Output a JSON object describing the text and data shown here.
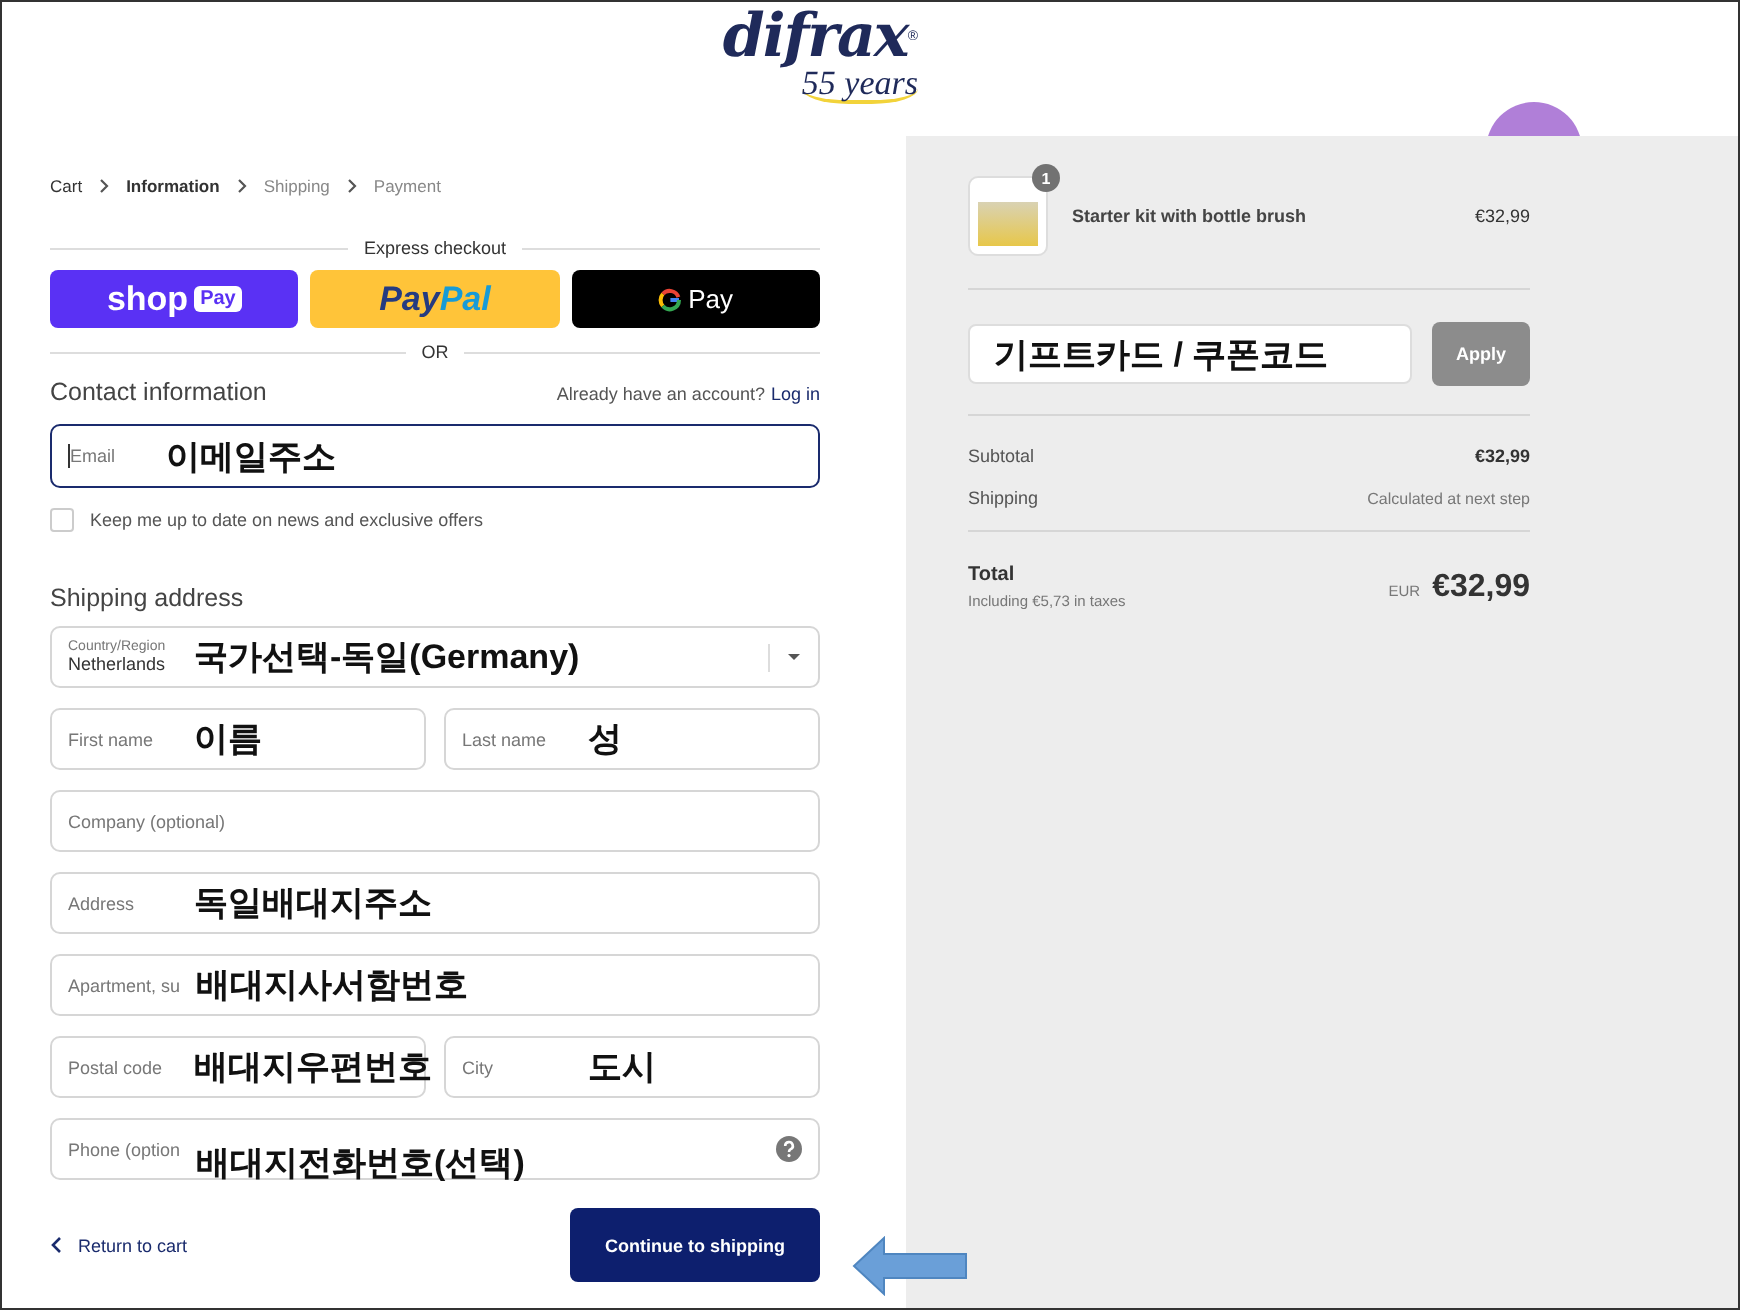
{
  "logo": {
    "wordmark": "difrax",
    "registered": "®",
    "tagline": "55 years"
  },
  "breadcrumbs": [
    {
      "label": "Cart",
      "selected": false,
      "disabled": false
    },
    {
      "label": "Information",
      "selected": true,
      "disabled": false
    },
    {
      "label": "Shipping",
      "selected": false,
      "disabled": true
    },
    {
      "label": "Payment",
      "selected": false,
      "disabled": true
    }
  ],
  "express_checkout": {
    "title": "Express checkout",
    "buttons": [
      {
        "kind": "shop",
        "label": "shop",
        "badge": "Pay"
      },
      {
        "kind": "paypal",
        "label": "Pay",
        "label_2": "Pal"
      },
      {
        "kind": "gpay",
        "label": "Pay"
      }
    ],
    "divider": "OR"
  },
  "contact": {
    "title": "Contact information",
    "account_prompt": "Already have an account?",
    "login_link": "Log in",
    "email": {
      "placeholder": "Email",
      "focused": true,
      "note": "이메일주소"
    },
    "newsletter": {
      "label": "Keep me up to date on news and exclusive offers",
      "checked": false
    }
  },
  "shipping": {
    "title": "Shipping address",
    "rows": [
      [
        {
          "kind": "select",
          "label": "Country/Region",
          "value": "Netherlands",
          "note": "국가선택-독일(Germany)"
        }
      ],
      [
        {
          "kind": "text",
          "placeholder": "First name",
          "note": "이름"
        },
        {
          "kind": "text",
          "placeholder": "Last name",
          "note": "성"
        }
      ],
      [
        {
          "kind": "text",
          "placeholder": "Company (optional)"
        }
      ],
      [
        {
          "kind": "text",
          "placeholder": "Address",
          "note": "독일배대지주소"
        }
      ],
      [
        {
          "kind": "text",
          "placeholder": "Apartment, su",
          "note": "배대지사서함번호"
        }
      ],
      [
        {
          "kind": "text",
          "placeholder": "Postal code",
          "note": "배대지우편번호"
        },
        {
          "kind": "text",
          "placeholder": "City",
          "note": "도시"
        }
      ],
      [
        {
          "kind": "phone",
          "placeholder": "Phone (option",
          "note": "배대지전화번호(선택)"
        }
      ]
    ]
  },
  "footer": {
    "return_link": "Return to cart",
    "continue_button": "Continue to shipping"
  },
  "summary": {
    "items": [
      {
        "name": "Starter kit with bottle brush",
        "price": "€32,99",
        "quantity": "1"
      }
    ],
    "discount": {
      "note": "기프트카드 / 쿠폰코드",
      "button": "Apply",
      "disabled": true
    },
    "lines": [
      {
        "kind": "amount",
        "label": "Subtotal",
        "value": "€32,99"
      },
      {
        "kind": "note",
        "label": "Shipping",
        "value": "Calculated at next step"
      }
    ],
    "total": {
      "label": "Total",
      "taxes": "Including €5,73 in taxes",
      "currency": "EUR",
      "amount": "€32,99"
    }
  }
}
